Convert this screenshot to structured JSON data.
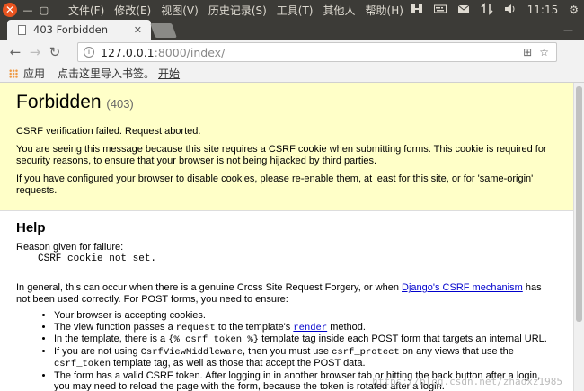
{
  "topbar": {
    "close_glyph": "✕",
    "menu": [
      "文件(F)",
      "修改(E)",
      "视图(V)",
      "历史记录(S)",
      "工具(T)",
      "其他人",
      "帮助(H)"
    ],
    "clock": "11:15"
  },
  "tab": {
    "title": "403 Forbidden"
  },
  "omnibox": {
    "host": "127.0.0.1",
    "path": ":8000/index/"
  },
  "bookmarks": {
    "apps": "应用",
    "import": "点击这里导入书签。",
    "start": "开始"
  },
  "summary": {
    "title": "Forbidden",
    "code": "(403)",
    "p1": "CSRF verification failed. Request aborted.",
    "p2": "You are seeing this message because this site requires a CSRF cookie when submitting forms. This cookie is required for security reasons, to ensure that your browser is not being hijacked by third parties.",
    "p3": "If you have configured your browser to disable cookies, please re-enable them, at least for this site, or for 'same-origin' requests."
  },
  "help": {
    "heading": "Help",
    "reason_label": "Reason given for failure:",
    "reason": "CSRF cookie not set.",
    "intro_before": "In general, this can occur when there is a genuine Cross Site Request Forgery, or when ",
    "intro_link": "Django's CSRF mechanism",
    "intro_after": " has not been used correctly. For POST forms, you need to ensure:",
    "li1": "Your browser is accepting cookies.",
    "li2_a": "The view function passes a ",
    "li2_code": "request",
    "li2_b": " to the template's ",
    "li2_link": "render",
    "li2_c": " method.",
    "li3_a": "In the template, there is a ",
    "li3_code": "{% csrf_token %}",
    "li3_b": " template tag inside each POST form that targets an internal URL.",
    "li4_a": "If you are not using ",
    "li4_code1": "CsrfViewMiddleware",
    "li4_b": ", then you must use ",
    "li4_code2": "csrf_protect",
    "li4_c": " on any views that use the ",
    "li4_code3": "csrf_token",
    "li4_d": " template tag, as well as those that accept the POST data.",
    "li5": "The form has a valid CSRF token. After logging in in another browser tab or hitting the back button after a login, you may need to reload the page with the form, because the token is rotated after a login."
  },
  "watermark": "https://blog.csdn.net/zhaoxz1985"
}
